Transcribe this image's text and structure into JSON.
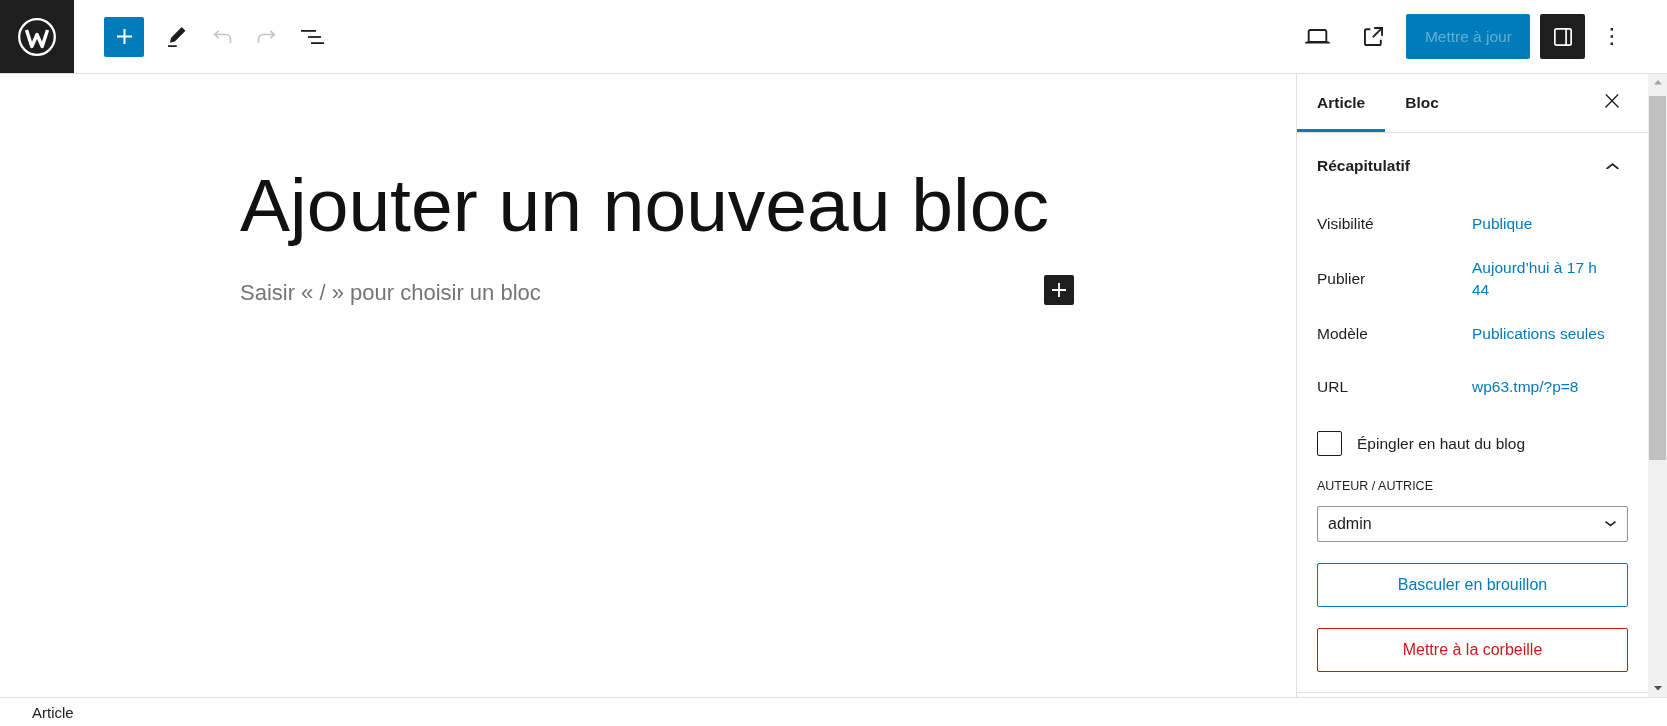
{
  "header": {
    "left_tools": [
      {
        "kind": "inserter",
        "disabled": false
      },
      {
        "kind": "tools",
        "disabled": false
      },
      {
        "kind": "undo",
        "disabled": true
      },
      {
        "kind": "redo",
        "disabled": true
      },
      {
        "kind": "document-overview",
        "disabled": false
      }
    ],
    "right_tools": [
      {
        "kind": "preview"
      },
      {
        "kind": "view-post"
      }
    ],
    "update_button": {
      "label": "Mettre à jour",
      "disabled": true
    },
    "settings_toggle": {
      "pressed": true
    }
  },
  "editor": {
    "title": "Ajouter un nouveau bloc",
    "paragraph": {
      "placeholder": "Saisir « / » pour choisir un bloc"
    }
  },
  "sidebar": {
    "tabs": [
      {
        "label": "Article",
        "selected": true
      },
      {
        "label": "Bloc",
        "selected": false
      }
    ],
    "panel": {
      "title": "Récapitulatif",
      "expanded": true,
      "rows": [
        {
          "label": "Visibilité",
          "value": "Publique"
        },
        {
          "label": "Publier",
          "value": "Aujourd’hui à 17 h 44"
        },
        {
          "label": "Modèle",
          "value": "Publications seules"
        },
        {
          "label": "URL",
          "value": "wp63.tmp/?p=8"
        }
      ],
      "sticky": {
        "label": "Épingler en haut du blog",
        "checked": false
      },
      "author": {
        "label": "AUTEUR / AUTRICE",
        "value": "admin"
      },
      "actions": [
        {
          "kind": "secondary",
          "label": "Basculer en brouillon"
        },
        {
          "kind": "destructive",
          "label": "Mettre à la corbeille"
        }
      ]
    }
  },
  "footer": {
    "breadcrumb": "Article"
  }
}
